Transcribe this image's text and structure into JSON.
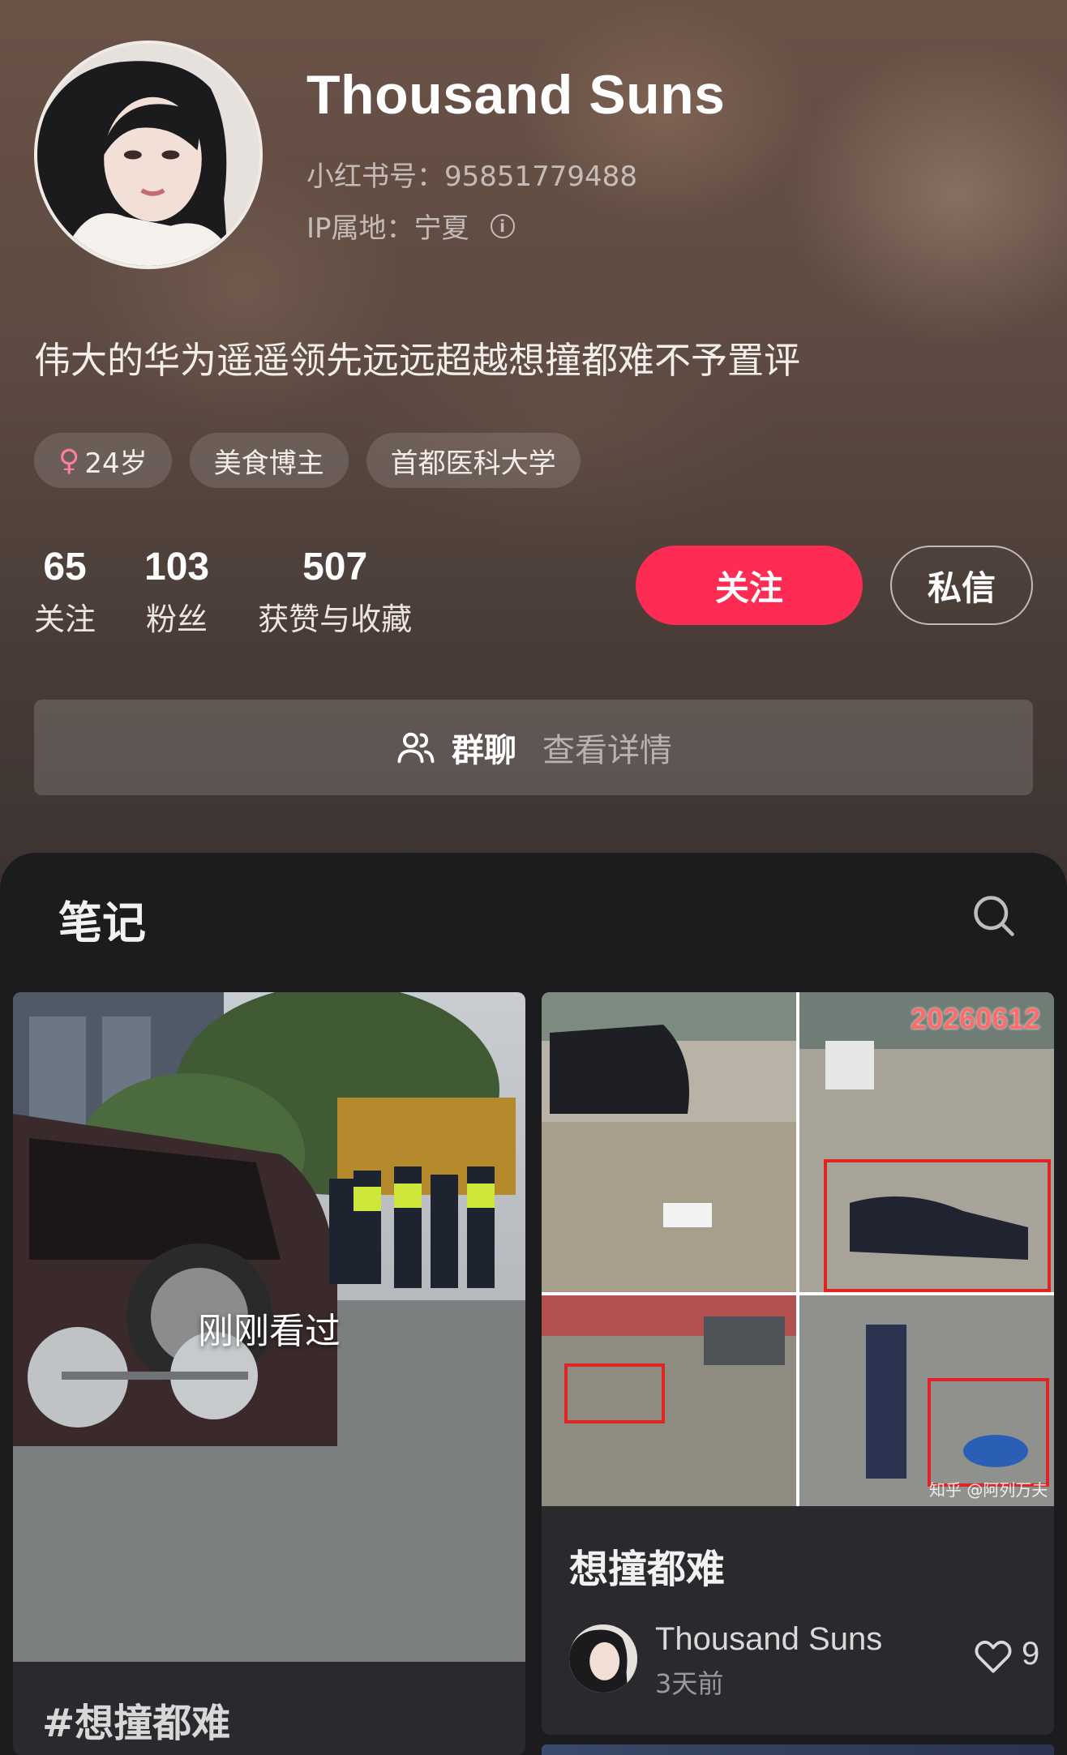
{
  "profile": {
    "name": "Thousand Suns",
    "id_line": "小红书号：95851779488",
    "ip_line": "IP属地：宁夏",
    "bio": "伟大的华为遥遥领先远远超越想撞都难不予置评",
    "tags": {
      "age": "24岁",
      "role": "美食博主",
      "school": "首都医科大学"
    },
    "stats": {
      "following": "65",
      "following_label": "关注",
      "followers": "103",
      "followers_label": "粉丝",
      "likes": "507",
      "likes_label": "获赞与收藏"
    },
    "follow_label": "关注",
    "message_label": "私信",
    "group_label": "群聊",
    "group_detail": "查看详情"
  },
  "notes": {
    "title": "笔记",
    "cards": [
      {
        "overlay": "刚刚看过",
        "caption": "#想撞都难"
      },
      {
        "date_stamp": "20260612",
        "watermark": "知乎 @阿列万夫",
        "title": "想撞都难",
        "author": "Thousand Suns",
        "time": "3天前",
        "likes": "9"
      }
    ]
  },
  "colors": {
    "accent": "#fe2c55",
    "header_bg": "#5d4a42",
    "panel_bg": "#1c1c1f"
  },
  "icons": [
    "female-icon",
    "info-icon",
    "group-icon",
    "search-icon",
    "heart-icon"
  ]
}
